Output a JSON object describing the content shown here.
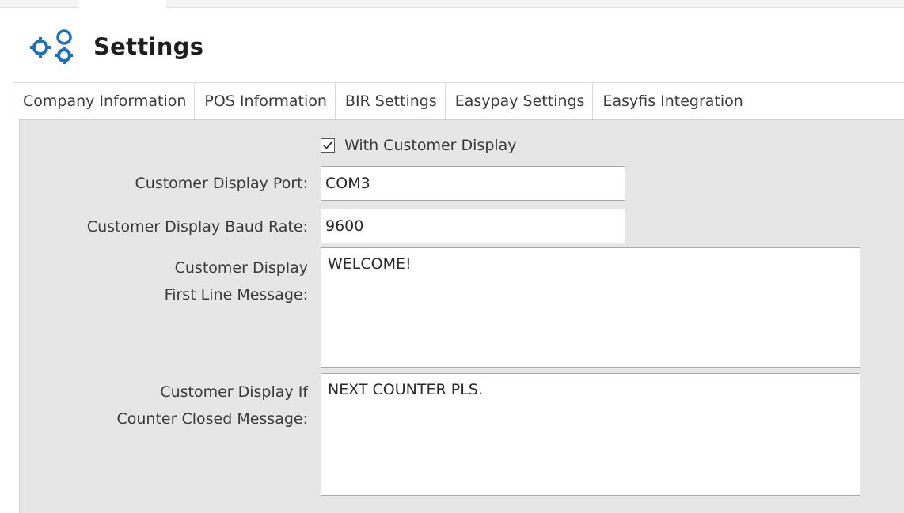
{
  "header": {
    "title": "Settings",
    "icon": "gears-icon"
  },
  "tabs": [
    {
      "label": "Company Information"
    },
    {
      "label": "POS Information"
    },
    {
      "label": "BIR Settings"
    },
    {
      "label": "Easypay Settings"
    },
    {
      "label": "Easyfis Integration"
    }
  ],
  "form": {
    "with_customer_display": {
      "label": "With Customer Display",
      "checked": true
    },
    "port": {
      "label": "Customer Display Port:",
      "value": "COM3"
    },
    "baud_rate": {
      "label": "Customer Display Baud Rate:",
      "value": "9600"
    },
    "first_line": {
      "label_line1": "Customer Display",
      "label_line2": "First Line Message:",
      "value": "WELCOME!"
    },
    "closed_message": {
      "label_line1": "Customer Display If",
      "label_line2": "Counter Closed Message:",
      "value": "NEXT COUNTER PLS."
    }
  },
  "colors": {
    "icon_blue": "#1f6fb8",
    "panel_bg": "#e6e6e6"
  }
}
